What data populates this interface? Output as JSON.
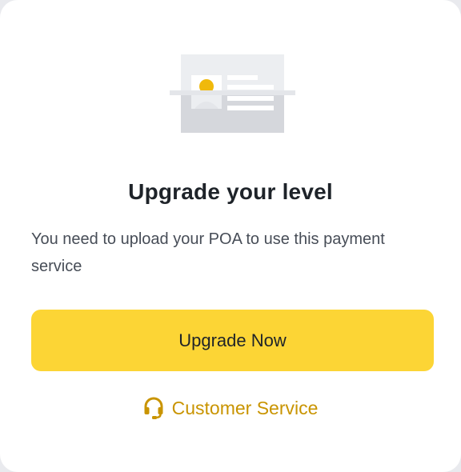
{
  "dialog": {
    "illustration_icon": "id-card-illustration",
    "title": "Upgrade your level",
    "message": "You need to upload your POA to use this payment service",
    "primary_button": {
      "label": "Upgrade Now",
      "color": "#fcd535"
    },
    "customer_service": {
      "icon": "headset-icon",
      "label": "Customer Service",
      "color": "#c99400"
    }
  }
}
